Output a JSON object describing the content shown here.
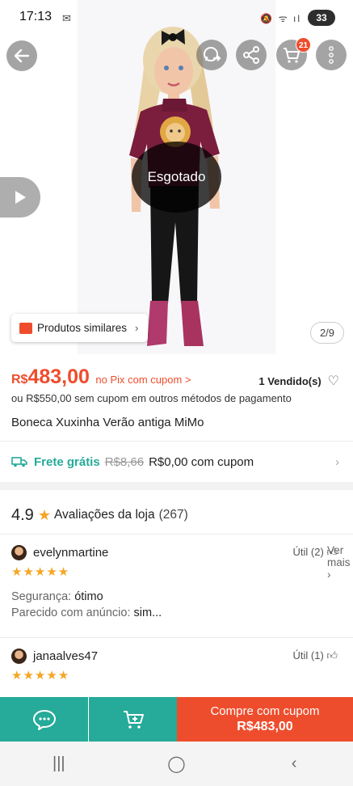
{
  "status_bar": {
    "time": "17:13",
    "battery": "33"
  },
  "image": {
    "badge_count": "21",
    "overlay": "Esgotado",
    "pager": "2/9",
    "similar_label": "Produtos similares"
  },
  "price": {
    "currency": "R$",
    "value": "483,00",
    "pix_note": "no Pix com cupom >",
    "sold": "1 Vendido(s)",
    "alt": "ou R$550,00 sem cupom em outros métodos de pagamento"
  },
  "product": {
    "title": "Boneca Xuxinha Verão antiga MiMo"
  },
  "shipping": {
    "label": "Frete grátis",
    "old_price": "R$8,66",
    "new_price": "R$0,00 com cupom"
  },
  "reviews": {
    "score": "4.9",
    "label": "Avaliações da loja",
    "count": "(267)",
    "see_more": "Ver mais",
    "items": [
      {
        "user": "evelynmartine",
        "helpful": "Útil (2)",
        "stars": "★★★★★",
        "details": [
          {
            "key": "Segurança:",
            "value": "ótimo"
          },
          {
            "key": "Parecido com anúncio:",
            "value": "sim..."
          }
        ]
      },
      {
        "user": "janaalves47",
        "helpful": "Útil (1)",
        "stars": "★★★★★",
        "details": []
      }
    ]
  },
  "bottom_bar": {
    "buy_line1": "Compre com cupom",
    "buy_line2": "R$483,00"
  },
  "colors": {
    "accent": "#ee4d2d",
    "teal": "#26aa99",
    "star": "#f5a623"
  }
}
